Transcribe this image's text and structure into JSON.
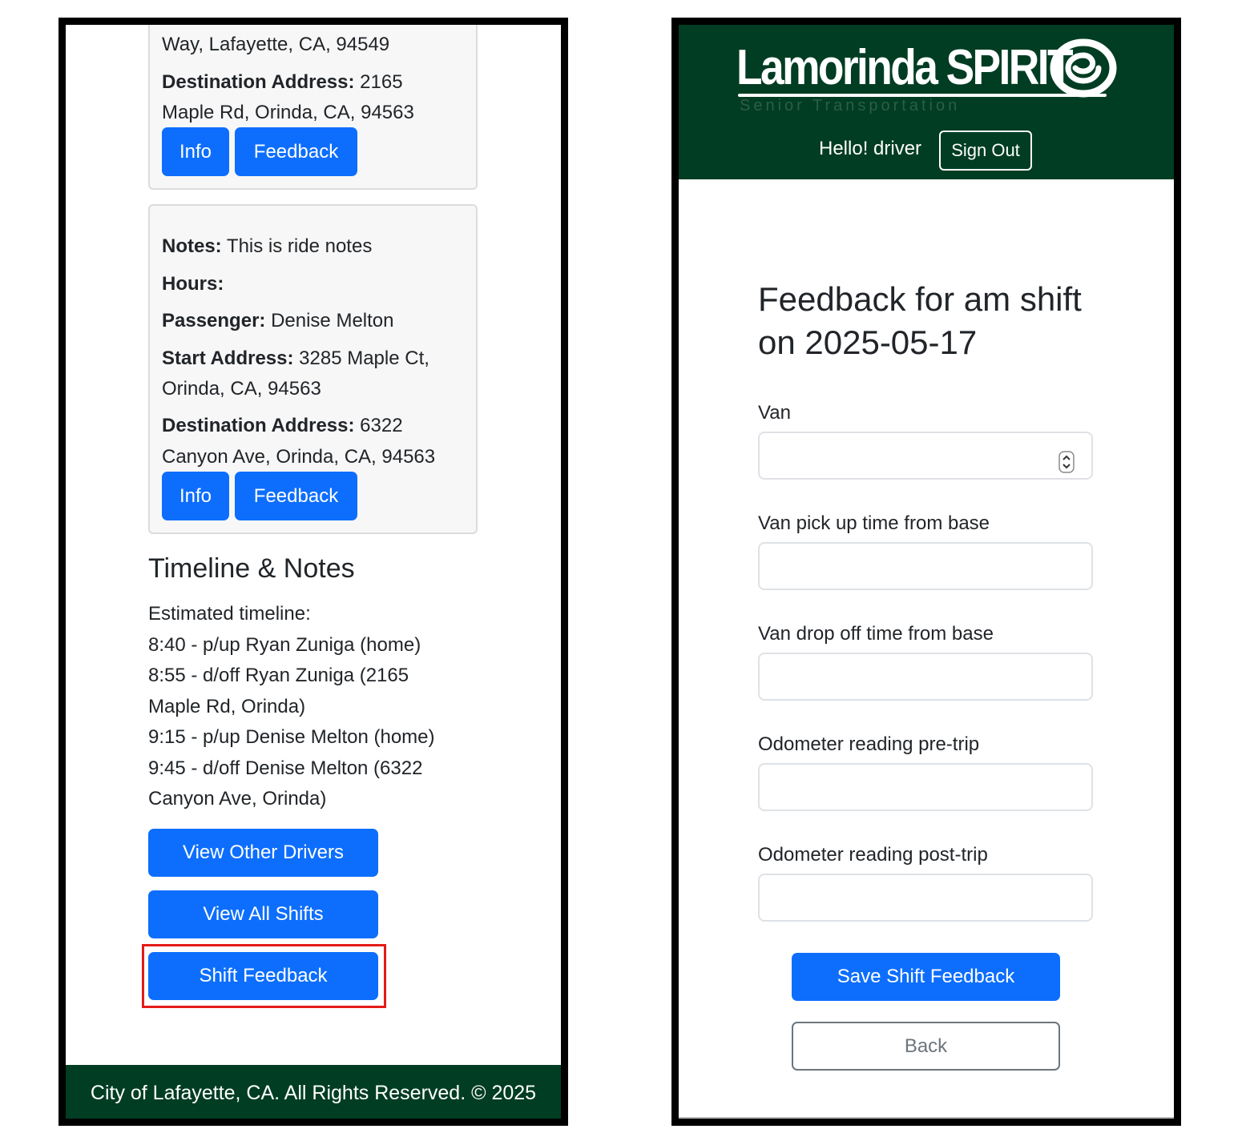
{
  "left_screen": {
    "ride1": {
      "start_addr_tail": "Way, Lafayette, CA, 94549",
      "dest_label": "Destination Address:",
      "dest_value_1": " 2165",
      "dest_value_2": "Maple Rd, Orinda, CA, 94563",
      "info_label": "Info",
      "feedback_label": "Feedback"
    },
    "ride2": {
      "notes_label": "Notes:",
      "notes_value": " This is ride notes",
      "hours_label": "Hours:",
      "passenger_label": "Passenger:",
      "passenger_value": " Denise Melton",
      "start_label": "Start Address:",
      "start_value_1": " 3285 Maple Ct,",
      "start_value_2": "Orinda, CA, 94563",
      "dest_label": "Destination Address:",
      "dest_value_1": " 6322",
      "dest_value_2": "Canyon Ave, Orinda, CA, 94563",
      "info_label": "Info",
      "feedback_label": "Feedback"
    },
    "timeline": {
      "heading": "Timeline & Notes",
      "lines": [
        "Estimated timeline:",
        "8:40 - p/up Ryan Zuniga (home)",
        "8:55 - d/off Ryan Zuniga (2165",
        "Maple Rd, Orinda)",
        "9:15 - p/up Denise Melton (home)",
        "9:45 - d/off Denise Melton (6322",
        "Canyon Ave, Orinda)"
      ]
    },
    "actions": {
      "view_other_drivers": "View Other Drivers",
      "view_all_shifts": "View All Shifts",
      "shift_feedback": "Shift Feedback"
    },
    "footer": "City of Lafayette, CA. All Rights Reserved. © 2025"
  },
  "right_screen": {
    "logo": {
      "name": "Lamorinda SPIRIT",
      "tagline": "Senior Transportation"
    },
    "greeting": "Hello! driver",
    "sign_out": "Sign Out",
    "title": "Feedback for am shift on 2025-05-17",
    "fields": [
      {
        "label": "Van",
        "value": ""
      },
      {
        "label": "Van pick up time from base",
        "value": ""
      },
      {
        "label": "Van drop off time from base",
        "value": ""
      },
      {
        "label": "Odometer reading pre-trip",
        "value": ""
      },
      {
        "label": "Odometer reading post-trip",
        "value": ""
      }
    ],
    "save_button": "Save Shift Feedback",
    "back_button": "Back"
  },
  "colors": {
    "primary_blue": "#0d6efd",
    "brand_green": "#003d23",
    "highlight_red": "#e41b17",
    "outline_gray": "#6c757d"
  }
}
